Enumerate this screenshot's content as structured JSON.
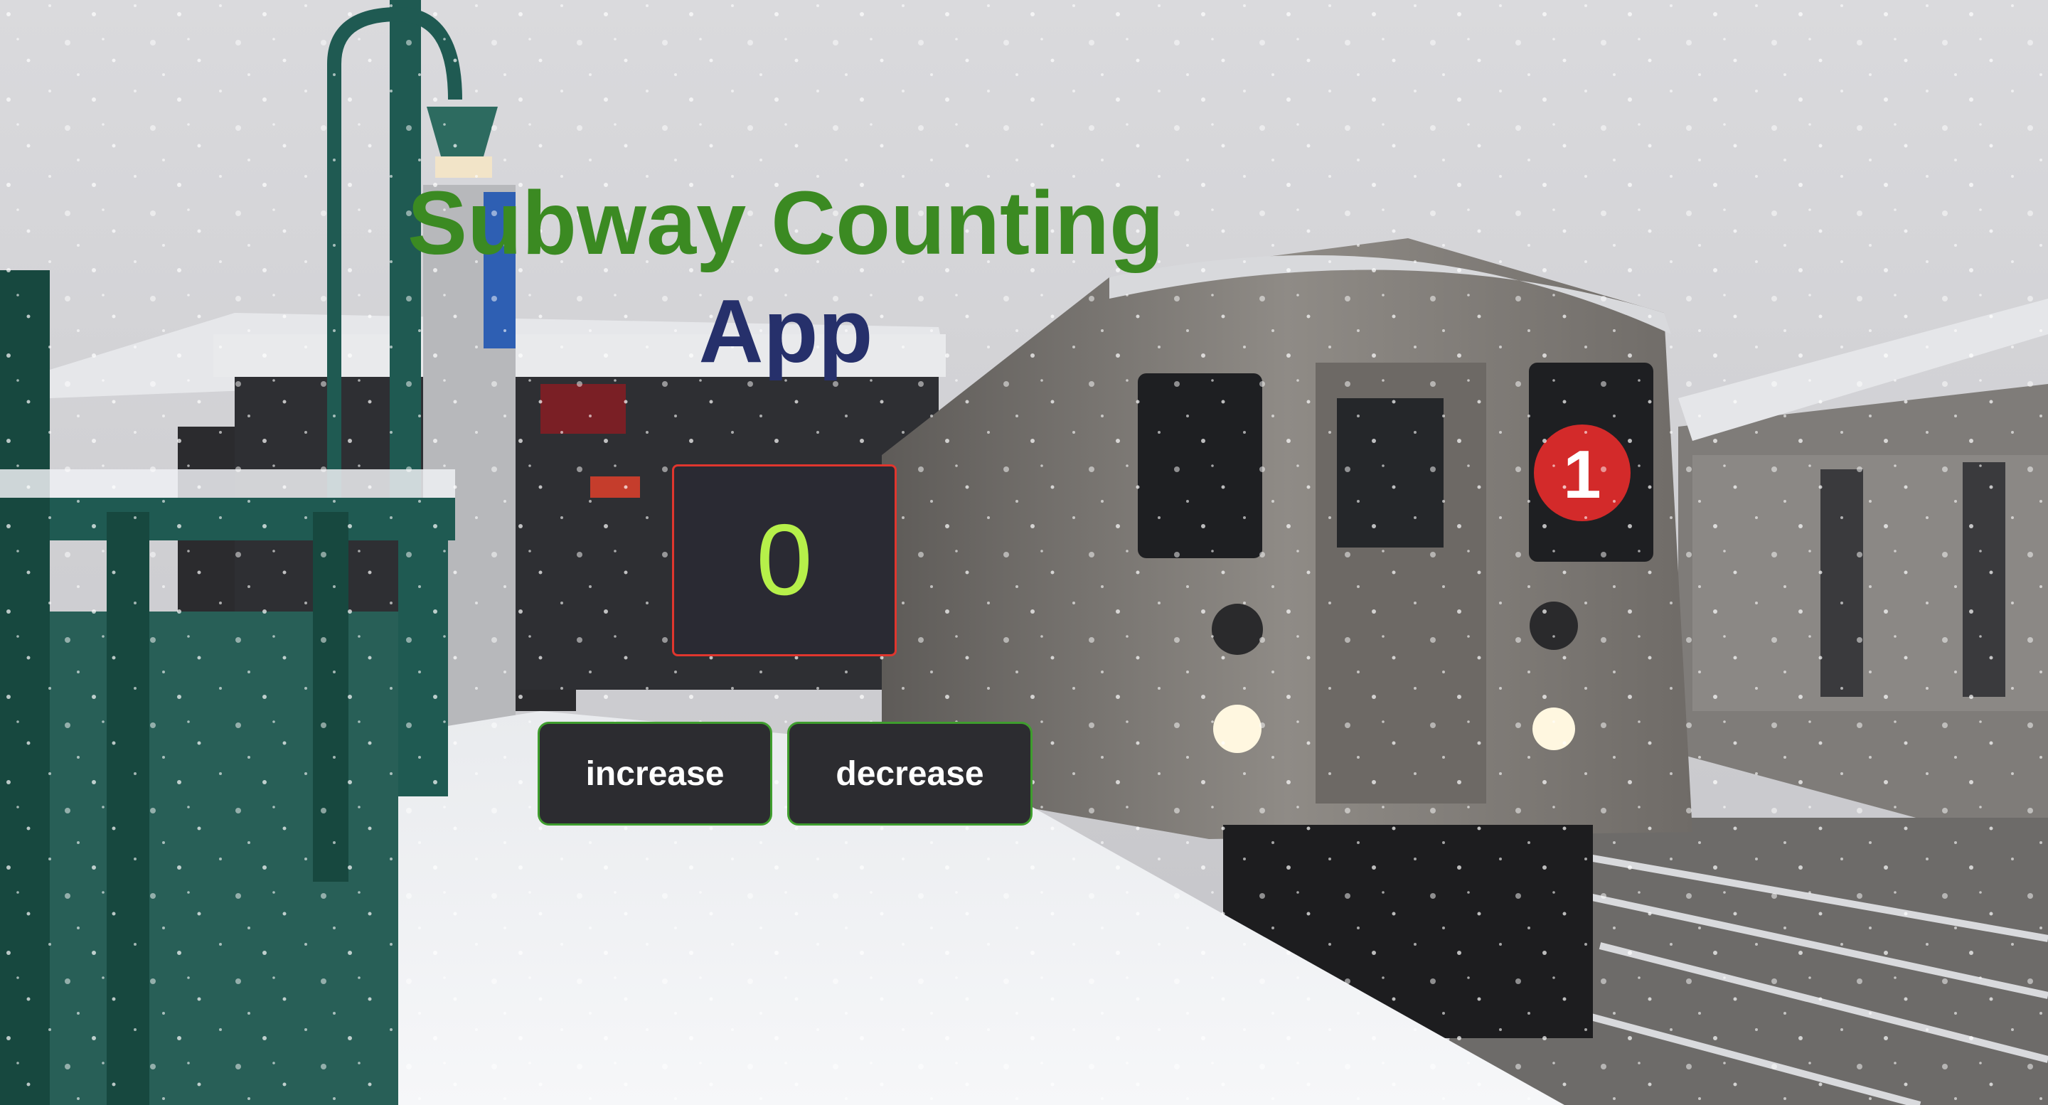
{
  "app": {
    "title_line1": "Subway Counting",
    "title_line2": "App",
    "count": "0"
  },
  "buttons": {
    "increase_label": "increase",
    "decrease_label": "decrease"
  },
  "background": {
    "route_badge": "1",
    "colors": {
      "sky": "#d3d3d6",
      "snow": "#eef0f3",
      "railing": "#1f5a52",
      "train": "#8e8a85",
      "route_badge": "#d32a2a"
    }
  },
  "colors": {
    "title_line1": "#3b8a22",
    "title_line2": "#26306b",
    "counter_bg": "#2a2a33",
    "counter_border": "#e0362e",
    "counter_text": "#b6f04a",
    "button_bg": "#2c2c30",
    "button_border": "#3f9d2e"
  }
}
